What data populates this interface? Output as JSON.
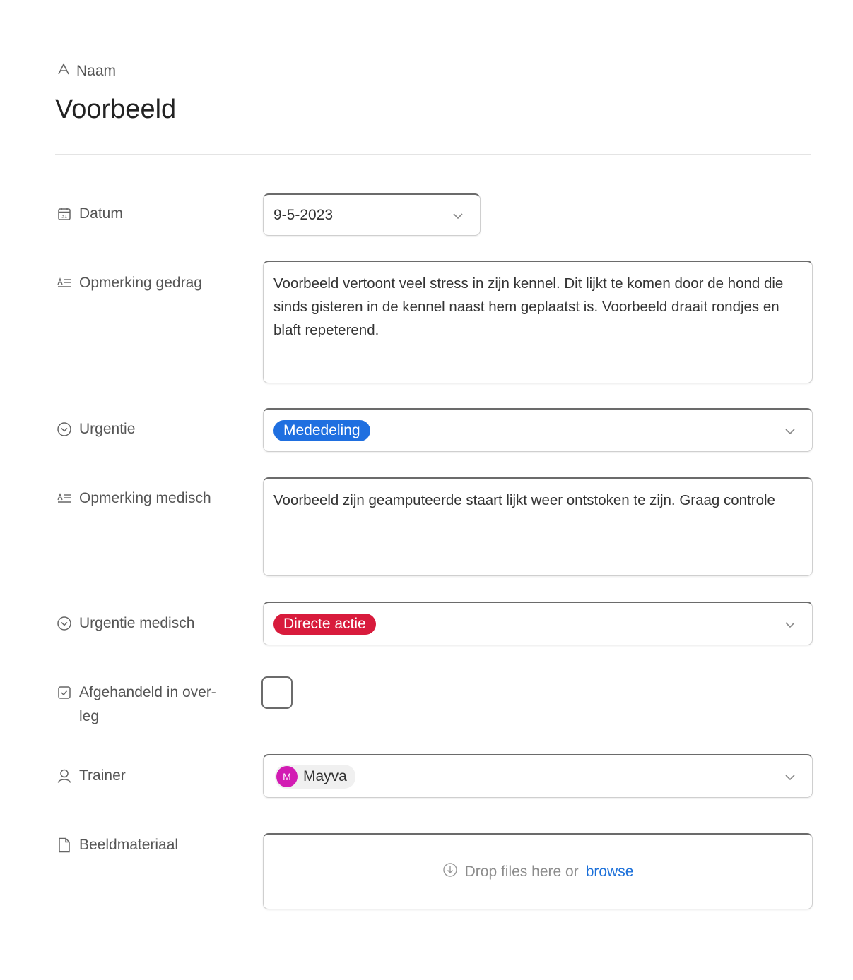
{
  "header": {
    "name_label": "Naam",
    "title": "Voorbeeld"
  },
  "fields": {
    "datum": {
      "label": "Datum",
      "value": "9-5-2023"
    },
    "opmerking_gedrag": {
      "label": "Opmerking gedrag",
      "value": "Voorbeeld vertoont veel stress in zijn kennel. Dit lijkt te komen door de hond die sinds gisteren in de kennel naast hem geplaatst is. Voorbeeld draait rondjes en blaft repeterend."
    },
    "urgentie": {
      "label": "Urgentie",
      "value": "Mededeling",
      "color": "#1f6fe0"
    },
    "opmerking_medisch": {
      "label": "Opmerking medisch",
      "value": "Voorbeeld zijn geamputeerde staart lijkt weer ontstoken te zijn. Graag controle"
    },
    "urgentie_medisch": {
      "label": "Urgentie medisch",
      "value": "Directe actie",
      "color": "#d81b3c"
    },
    "afgehandeld": {
      "label_line1": "Afgehandeld in over-",
      "label_line2": "leg",
      "checked": false
    },
    "trainer": {
      "label": "Trainer",
      "value": "Mayva",
      "avatar_initial": "M",
      "avatar_color": "#d21bb3"
    },
    "beeldmateriaal": {
      "label": "Beeldmateriaal",
      "drop_text": "Drop files here or",
      "browse_text": "browse"
    }
  },
  "icons": {
    "name": "text-type-icon",
    "datum": "calendar-icon",
    "opmerking": "long-text-icon",
    "urgentie": "single-select-icon",
    "afgehandeld": "checkbox-icon",
    "trainer": "user-icon",
    "beeldmateriaal": "file-icon",
    "dropdown": "chevron-down-icon",
    "upload": "upload-arrow-icon"
  }
}
